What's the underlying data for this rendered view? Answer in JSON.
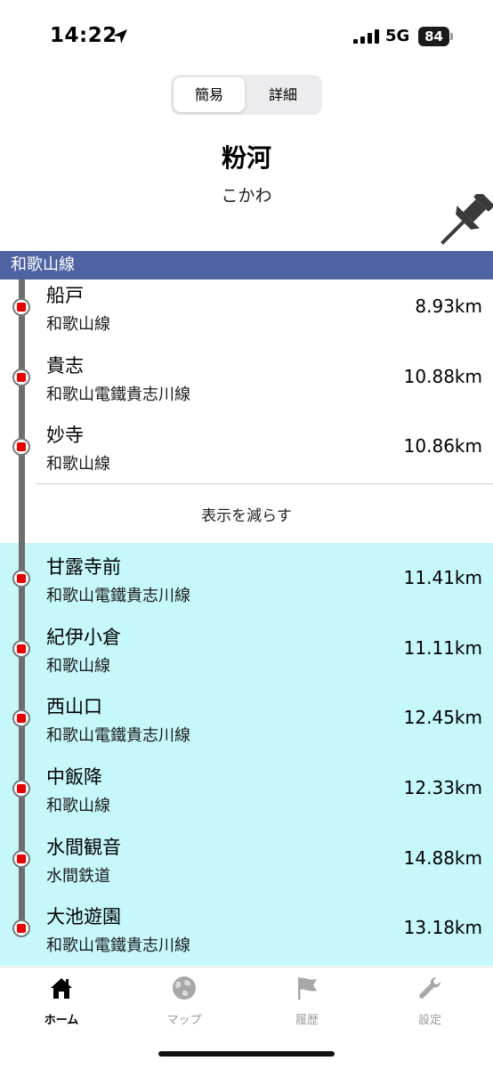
{
  "status_bar": {
    "time": "14:22",
    "network": "5G",
    "battery": "84"
  },
  "segmented": {
    "options": [
      "簡易",
      "詳細"
    ],
    "selected": "簡易"
  },
  "station": {
    "name": "粉河",
    "reading": "こかわ"
  },
  "line_header": "和歌山線",
  "stations_top": [
    {
      "name": "船戸",
      "line": "和歌山線",
      "distance": "8.93km"
    },
    {
      "name": "貴志",
      "line": "和歌山電鐵貴志川線",
      "distance": "10.88km"
    },
    {
      "name": "妙寺",
      "line": "和歌山線",
      "distance": "10.86km"
    }
  ],
  "show_less_label": "表示を減らす",
  "stations_highlighted": [
    {
      "name": "甘露寺前",
      "line": "和歌山電鐵貴志川線",
      "distance": "11.41km"
    },
    {
      "name": "紀伊小倉",
      "line": "和歌山線",
      "distance": "11.11km"
    },
    {
      "name": "西山口",
      "line": "和歌山電鐵貴志川線",
      "distance": "12.45km"
    },
    {
      "name": "中飯降",
      "line": "和歌山線",
      "distance": "12.33km"
    },
    {
      "name": "水間観音",
      "line": "水間鉄道",
      "distance": "14.88km"
    },
    {
      "name": "大池遊園",
      "line": "和歌山電鐵貴志川線",
      "distance": "13.18km"
    }
  ],
  "tabs": [
    {
      "label": "ホーム",
      "icon": "home-icon",
      "active": true
    },
    {
      "label": "マップ",
      "icon": "globe-icon",
      "active": false
    },
    {
      "label": "履歴",
      "icon": "flag-icon",
      "active": false
    },
    {
      "label": "設定",
      "icon": "wrench-icon",
      "active": false
    }
  ],
  "colors": {
    "line_header_bg": "#4f63a3",
    "highlight_bg": "#c6f7fb",
    "station_marker": "#e60000"
  }
}
